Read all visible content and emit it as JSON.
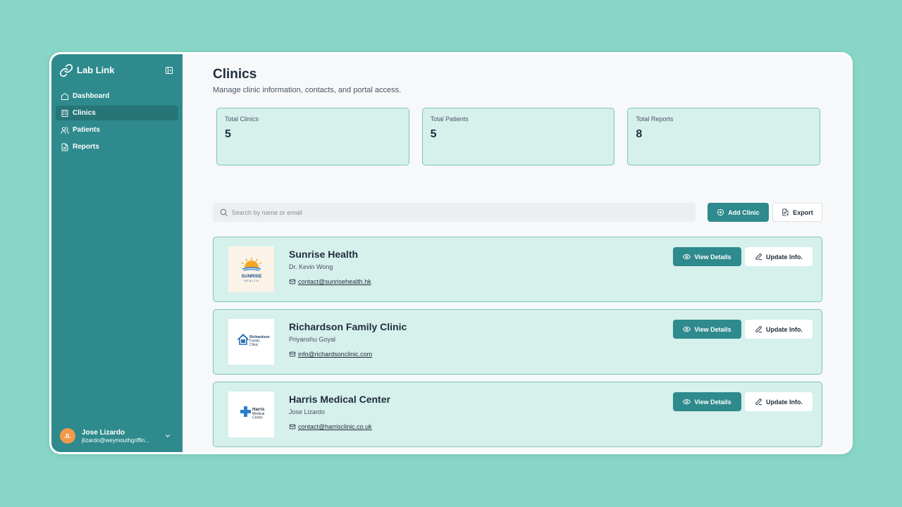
{
  "app": {
    "name": "Lab Link",
    "logo_icon": "link-icon",
    "collapse_icon": "sidebar-collapse-icon"
  },
  "sidebar": {
    "items": [
      {
        "label": "Dashboard",
        "icon": "home-icon",
        "active": false
      },
      {
        "label": "Clinics",
        "icon": "building-icon",
        "active": true
      },
      {
        "label": "Patients",
        "icon": "users-icon",
        "active": false
      },
      {
        "label": "Reports",
        "icon": "file-text-icon",
        "active": false
      }
    ],
    "user": {
      "initials": "JL",
      "name": "Jose Lizardo",
      "email": "jlizardo@weymouthgriffin..."
    }
  },
  "page": {
    "title": "Clinics",
    "subtitle": "Manage clinic information, contacts, and portal access."
  },
  "stats": [
    {
      "label": "Total Clinics",
      "value": "5"
    },
    {
      "label": "Total Patients",
      "value": "5"
    },
    {
      "label": "Total Reports",
      "value": "8"
    }
  ],
  "toolbar": {
    "search_placeholder": "Search by name or email",
    "add_label": "Add Clinic",
    "export_label": "Export"
  },
  "clinics": [
    {
      "name": "Sunrise Health",
      "contact": "Dr. Kevin Wong",
      "email": "contact@sunrisehealth.hk",
      "logo_text": [
        "SUNRISE",
        "HEALTH"
      ],
      "view_label": "View Details",
      "update_label": "Update Info."
    },
    {
      "name": "Richardson Family Clinic",
      "contact": "Priyanshu Goyal",
      "email": "info@richardsonclinic.com",
      "logo_text": [
        "Richardson",
        "Family",
        "Clinic"
      ],
      "view_label": "View Details",
      "update_label": "Update Info."
    },
    {
      "name": "Harris Medical Center",
      "contact": "Jose Lizardo",
      "email": "contact@harrisclinic.co.uk",
      "logo_text": [
        "Harris",
        "Medical",
        "Center"
      ],
      "view_label": "View Details",
      "update_label": "Update Info."
    }
  ],
  "colors": {
    "background": "#87d6c6",
    "sidebar": "#2e8a8c",
    "sidebar_active": "#267577",
    "card": "#d6f0ec",
    "card_border": "#7cc6ba",
    "primary": "#2e8a8c",
    "avatar": "#f29a4a"
  }
}
